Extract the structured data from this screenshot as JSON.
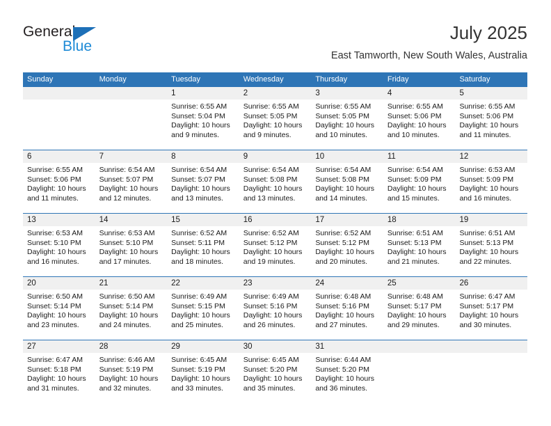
{
  "brand": {
    "name_part1": "General",
    "name_part2": "Blue",
    "triangle_icon": "triangle-icon",
    "accent_color": "#1d8ad6",
    "logo_dark_color": "#231f20"
  },
  "header": {
    "title": "July 2025",
    "subtitle": "East Tamworth, New South Wales, Australia"
  },
  "calendar": {
    "header_bg": "#2e75b6",
    "daynum_bg": "#f0f0f0",
    "weekdays": [
      "Sunday",
      "Monday",
      "Tuesday",
      "Wednesday",
      "Thursday",
      "Friday",
      "Saturday"
    ],
    "weeks": [
      [
        {
          "date": "",
          "sunrise": "",
          "sunset": "",
          "daylight": "",
          "empty": true
        },
        {
          "date": "",
          "sunrise": "",
          "sunset": "",
          "daylight": "",
          "empty": true
        },
        {
          "date": "1",
          "sunrise": "Sunrise: 6:55 AM",
          "sunset": "Sunset: 5:04 PM",
          "daylight": "Daylight: 10 hours and 9 minutes."
        },
        {
          "date": "2",
          "sunrise": "Sunrise: 6:55 AM",
          "sunset": "Sunset: 5:05 PM",
          "daylight": "Daylight: 10 hours and 9 minutes."
        },
        {
          "date": "3",
          "sunrise": "Sunrise: 6:55 AM",
          "sunset": "Sunset: 5:05 PM",
          "daylight": "Daylight: 10 hours and 10 minutes."
        },
        {
          "date": "4",
          "sunrise": "Sunrise: 6:55 AM",
          "sunset": "Sunset: 5:06 PM",
          "daylight": "Daylight: 10 hours and 10 minutes."
        },
        {
          "date": "5",
          "sunrise": "Sunrise: 6:55 AM",
          "sunset": "Sunset: 5:06 PM",
          "daylight": "Daylight: 10 hours and 11 minutes."
        }
      ],
      [
        {
          "date": "6",
          "sunrise": "Sunrise: 6:55 AM",
          "sunset": "Sunset: 5:06 PM",
          "daylight": "Daylight: 10 hours and 11 minutes."
        },
        {
          "date": "7",
          "sunrise": "Sunrise: 6:54 AM",
          "sunset": "Sunset: 5:07 PM",
          "daylight": "Daylight: 10 hours and 12 minutes."
        },
        {
          "date": "8",
          "sunrise": "Sunrise: 6:54 AM",
          "sunset": "Sunset: 5:07 PM",
          "daylight": "Daylight: 10 hours and 13 minutes."
        },
        {
          "date": "9",
          "sunrise": "Sunrise: 6:54 AM",
          "sunset": "Sunset: 5:08 PM",
          "daylight": "Daylight: 10 hours and 13 minutes."
        },
        {
          "date": "10",
          "sunrise": "Sunrise: 6:54 AM",
          "sunset": "Sunset: 5:08 PM",
          "daylight": "Daylight: 10 hours and 14 minutes."
        },
        {
          "date": "11",
          "sunrise": "Sunrise: 6:54 AM",
          "sunset": "Sunset: 5:09 PM",
          "daylight": "Daylight: 10 hours and 15 minutes."
        },
        {
          "date": "12",
          "sunrise": "Sunrise: 6:53 AM",
          "sunset": "Sunset: 5:09 PM",
          "daylight": "Daylight: 10 hours and 16 minutes."
        }
      ],
      [
        {
          "date": "13",
          "sunrise": "Sunrise: 6:53 AM",
          "sunset": "Sunset: 5:10 PM",
          "daylight": "Daylight: 10 hours and 16 minutes."
        },
        {
          "date": "14",
          "sunrise": "Sunrise: 6:53 AM",
          "sunset": "Sunset: 5:10 PM",
          "daylight": "Daylight: 10 hours and 17 minutes."
        },
        {
          "date": "15",
          "sunrise": "Sunrise: 6:52 AM",
          "sunset": "Sunset: 5:11 PM",
          "daylight": "Daylight: 10 hours and 18 minutes."
        },
        {
          "date": "16",
          "sunrise": "Sunrise: 6:52 AM",
          "sunset": "Sunset: 5:12 PM",
          "daylight": "Daylight: 10 hours and 19 minutes."
        },
        {
          "date": "17",
          "sunrise": "Sunrise: 6:52 AM",
          "sunset": "Sunset: 5:12 PM",
          "daylight": "Daylight: 10 hours and 20 minutes."
        },
        {
          "date": "18",
          "sunrise": "Sunrise: 6:51 AM",
          "sunset": "Sunset: 5:13 PM",
          "daylight": "Daylight: 10 hours and 21 minutes."
        },
        {
          "date": "19",
          "sunrise": "Sunrise: 6:51 AM",
          "sunset": "Sunset: 5:13 PM",
          "daylight": "Daylight: 10 hours and 22 minutes."
        }
      ],
      [
        {
          "date": "20",
          "sunrise": "Sunrise: 6:50 AM",
          "sunset": "Sunset: 5:14 PM",
          "daylight": "Daylight: 10 hours and 23 minutes."
        },
        {
          "date": "21",
          "sunrise": "Sunrise: 6:50 AM",
          "sunset": "Sunset: 5:14 PM",
          "daylight": "Daylight: 10 hours and 24 minutes."
        },
        {
          "date": "22",
          "sunrise": "Sunrise: 6:49 AM",
          "sunset": "Sunset: 5:15 PM",
          "daylight": "Daylight: 10 hours and 25 minutes."
        },
        {
          "date": "23",
          "sunrise": "Sunrise: 6:49 AM",
          "sunset": "Sunset: 5:16 PM",
          "daylight": "Daylight: 10 hours and 26 minutes."
        },
        {
          "date": "24",
          "sunrise": "Sunrise: 6:48 AM",
          "sunset": "Sunset: 5:16 PM",
          "daylight": "Daylight: 10 hours and 27 minutes."
        },
        {
          "date": "25",
          "sunrise": "Sunrise: 6:48 AM",
          "sunset": "Sunset: 5:17 PM",
          "daylight": "Daylight: 10 hours and 29 minutes."
        },
        {
          "date": "26",
          "sunrise": "Sunrise: 6:47 AM",
          "sunset": "Sunset: 5:17 PM",
          "daylight": "Daylight: 10 hours and 30 minutes."
        }
      ],
      [
        {
          "date": "27",
          "sunrise": "Sunrise: 6:47 AM",
          "sunset": "Sunset: 5:18 PM",
          "daylight": "Daylight: 10 hours and 31 minutes."
        },
        {
          "date": "28",
          "sunrise": "Sunrise: 6:46 AM",
          "sunset": "Sunset: 5:19 PM",
          "daylight": "Daylight: 10 hours and 32 minutes."
        },
        {
          "date": "29",
          "sunrise": "Sunrise: 6:45 AM",
          "sunset": "Sunset: 5:19 PM",
          "daylight": "Daylight: 10 hours and 33 minutes."
        },
        {
          "date": "30",
          "sunrise": "Sunrise: 6:45 AM",
          "sunset": "Sunset: 5:20 PM",
          "daylight": "Daylight: 10 hours and 35 minutes."
        },
        {
          "date": "31",
          "sunrise": "Sunrise: 6:44 AM",
          "sunset": "Sunset: 5:20 PM",
          "daylight": "Daylight: 10 hours and 36 minutes."
        },
        {
          "date": "",
          "sunrise": "",
          "sunset": "",
          "daylight": "",
          "empty": true
        },
        {
          "date": "",
          "sunrise": "",
          "sunset": "",
          "daylight": "",
          "empty": true
        }
      ]
    ]
  }
}
